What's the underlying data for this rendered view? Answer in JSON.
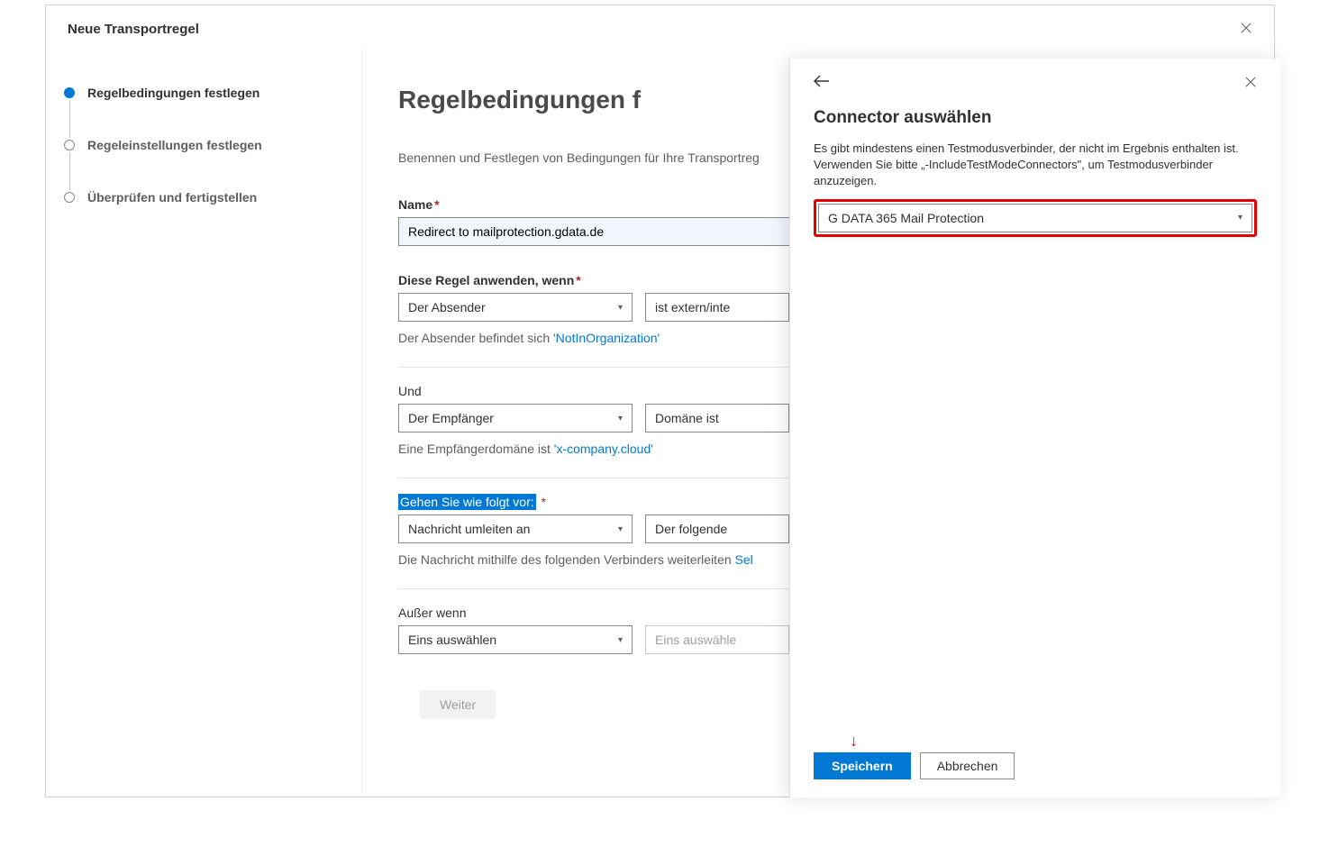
{
  "header": {
    "title": "Neue Transportregel"
  },
  "steps": [
    {
      "label": "Regelbedingungen festlegen",
      "active": true
    },
    {
      "label": "Regeleinstellungen festlegen",
      "active": false
    },
    {
      "label": "Überprüfen und fertigstellen",
      "active": false
    }
  ],
  "main": {
    "heading": "Regelbedingungen f",
    "description": "Benennen und Festlegen von Bedingungen für Ihre Transportreg",
    "name_label": "Name",
    "name_value": "Redirect to mailprotection.gdata.de",
    "apply_when_label": "Diese Regel anwenden, wenn",
    "sender_select": "Der Absender",
    "sender_cond_select": "ist extern/inte",
    "sender_helper_prefix": "Der Absender befindet sich ",
    "sender_helper_link": "'NotInOrganization'",
    "und_label": "Und",
    "recipient_select": "Der Empfänger",
    "recipient_cond_select": "Domäne ist",
    "recipient_helper_prefix": "Eine Empfängerdomäne ist ",
    "recipient_helper_link": "'x-company.cloud'",
    "do_label": "Gehen Sie wie folgt vor:",
    "redirect_select": "Nachricht umleiten an",
    "redirect_cond_select": "Der folgende",
    "redirect_helper_prefix": "Die Nachricht mithilfe des folgenden Verbinders weiterleiten ",
    "redirect_helper_link": "Sel",
    "except_label": "Außer wenn",
    "except_select": "Eins auswählen",
    "except_cond_select": "Eins auswähle",
    "next_button": "Weiter"
  },
  "panel": {
    "title": "Connector auswählen",
    "description": "Es gibt mindestens einen Testmodusverbinder, der nicht im Ergebnis enthalten ist. Verwenden Sie bitte „-IncludeTestModeConnectors\", um Testmodusverbinder anzuzeigen.",
    "selected_connector": "G DATA 365 Mail Protection",
    "save_button": "Speichern",
    "cancel_button": "Abbrechen"
  }
}
